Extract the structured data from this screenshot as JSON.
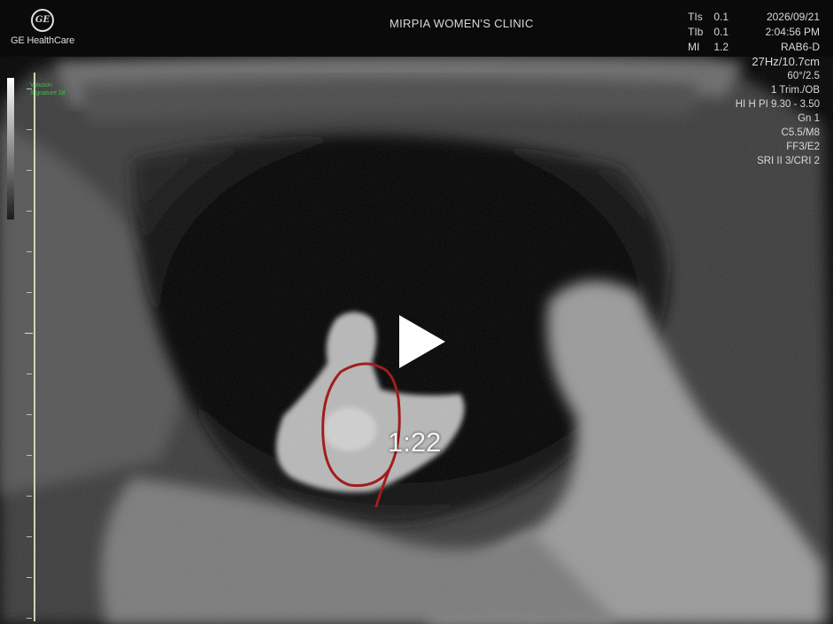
{
  "header": {
    "logo_mark": "GE",
    "brand": "GE HealthCare",
    "clinic": "MIRPIA WOMEN'S CLINIC",
    "params": [
      {
        "key": "TIs",
        "value": "0.1"
      },
      {
        "key": "TIb",
        "value": "0.1"
      },
      {
        "key": "MI",
        "value": "1.2"
      }
    ],
    "date": "2026/09/21",
    "time": "2:04:56 PM",
    "probe": "RAB6-D"
  },
  "settings": {
    "frequency_depth": "27Hz/10.7cm",
    "angle": "60°/2.5",
    "preset": "1 Trim./OB",
    "harmonic": "HI H PI 9.30 - 3.50",
    "gain": "Gn  1",
    "map": "C5.5/M8",
    "filter": "FF3/E2",
    "sri_cri": "SRI II 3/CRI 2"
  },
  "device": {
    "line1": "Voluson",
    "line2": "Signature 18"
  },
  "video": {
    "duration": "1:22",
    "play_icon": "play-icon"
  },
  "annotation": {
    "color": "#a31d1d",
    "icon": "circle-annotation"
  },
  "colors": {
    "ruler": "#cfd6b4",
    "model_text": "#39c24a"
  }
}
